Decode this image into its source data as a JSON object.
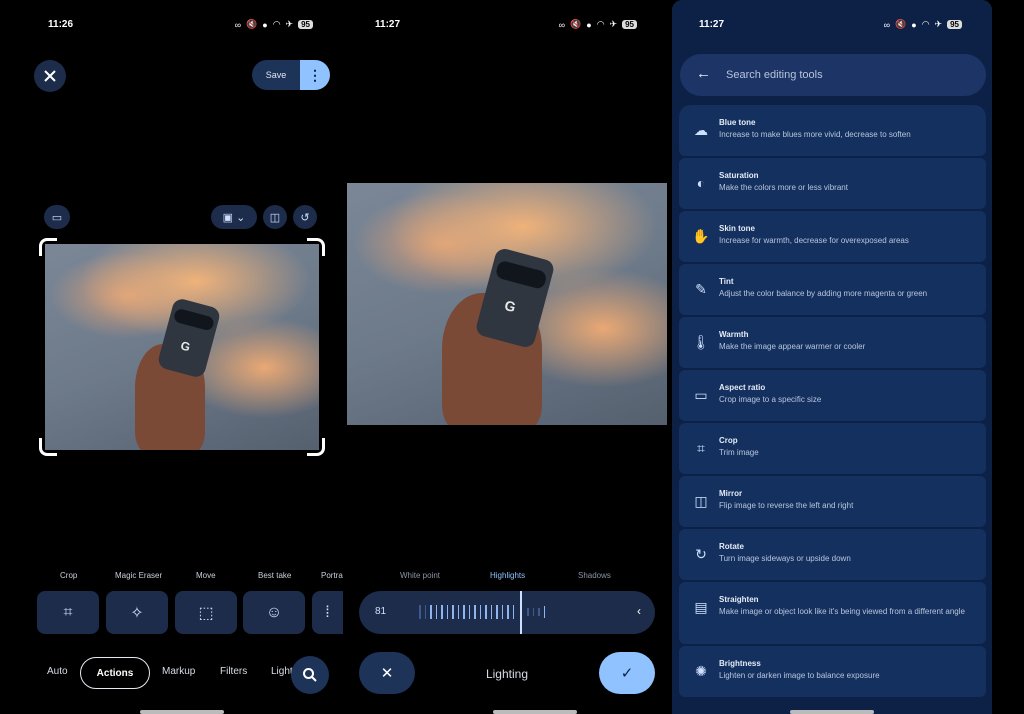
{
  "panel1": {
    "status": {
      "time": "11:26",
      "battery": "95"
    },
    "header": {
      "close_icon": "close-icon",
      "save_label": "Save",
      "more_icon": "more-vert-icon"
    },
    "tools": [
      {
        "label": "Crop",
        "icon": "crop-icon"
      },
      {
        "label": "Magic Eraser",
        "icon": "magic-eraser-icon"
      },
      {
        "label": "Move",
        "icon": "move-icon"
      },
      {
        "label": "Best take",
        "icon": "best-take-icon"
      },
      {
        "label": "Portra",
        "icon": "portrait-icon"
      }
    ],
    "tabs": [
      "Auto",
      "Actions",
      "Markup",
      "Filters",
      "Light"
    ],
    "active_tab": "Actions"
  },
  "panel2": {
    "status": {
      "time": "11:27",
      "battery": "95"
    },
    "light_tabs": [
      "White point",
      "Highlights",
      "Shadows"
    ],
    "active_light_tab": "Highlights",
    "slider_value": "81",
    "bottom_label": "Lighting"
  },
  "panel3": {
    "status": {
      "time": "11:27",
      "battery": "95"
    },
    "search_placeholder": "Search editing tools",
    "tools": [
      {
        "name": "Blue tone",
        "desc": "Increase to make blues more vivid, decrease to soften",
        "icon": "cloud-icon",
        "glyph": "☁"
      },
      {
        "name": "Saturation",
        "desc": "Make the colors more or less vibrant",
        "icon": "contrast-icon",
        "glyph": "◐"
      },
      {
        "name": "Skin tone",
        "desc": "Increase for warmth, decrease for overexposed areas",
        "icon": "hand-icon",
        "glyph": "✋"
      },
      {
        "name": "Tint",
        "desc": "Adjust the color balance by adding more magenta or green",
        "icon": "eyedropper-icon",
        "glyph": "✎"
      },
      {
        "name": "Warmth",
        "desc": "Make the image appear warmer or cooler",
        "icon": "thermometer-icon",
        "glyph": "🌡"
      },
      {
        "name": "Aspect ratio",
        "desc": "Crop image to a specific size",
        "icon": "aspect-ratio-icon",
        "glyph": "▭"
      },
      {
        "name": "Crop",
        "desc": "Trim image",
        "icon": "crop-icon",
        "glyph": "⌗"
      },
      {
        "name": "Mirror",
        "desc": "Flip image to reverse the left and right",
        "icon": "mirror-icon",
        "glyph": "◫"
      },
      {
        "name": "Rotate",
        "desc": "Turn image sideways or upside down",
        "icon": "rotate-icon",
        "glyph": "↻"
      },
      {
        "name": "Straighten",
        "desc": "Make image or object look like it's being viewed from a different angle",
        "icon": "straighten-icon",
        "glyph": "▤"
      },
      {
        "name": "Brightness",
        "desc": "Lighten or darken image to balance exposure",
        "icon": "brightness-icon",
        "glyph": "✺"
      }
    ]
  },
  "colors": {
    "accent": "#8fc2ff",
    "surface": "#1c2c4a",
    "panel3_bg": "#0d2147"
  }
}
